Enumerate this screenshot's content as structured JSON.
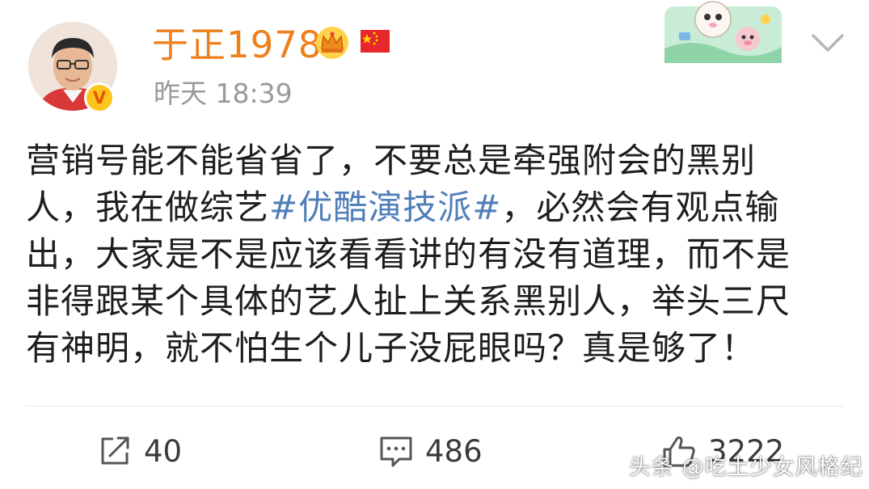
{
  "user": {
    "name": "于正1978",
    "verified_badge": "V",
    "timestamp": "昨天 18:39"
  },
  "post": {
    "text_line1": "营销号能不能省省了，不要总是牵强附会的黑别",
    "text_line2_pre": "人，我在做综艺",
    "hashtag": "#优酷演技派#",
    "text_line2_post": "，必然会有观点输",
    "text_line3": "出，大家是不是应该看看讲的有没有道理，而不是",
    "text_line4": "非得跟某个具体的艺人扯上关系黑别人，举头三尺",
    "text_line5": "有神明，就不怕生个儿子没屁眼吗？真是够了！"
  },
  "actions": {
    "repost_count": "40",
    "comment_count": "486",
    "like_count": "3222"
  },
  "watermark": "头条 @吃土少女风格纪",
  "icons": [
    "avatar",
    "crown-icon",
    "china-flag-icon",
    "sticker-icon",
    "chevron-down-icon",
    "repost-icon",
    "comment-icon",
    "like-icon"
  ],
  "colors": {
    "username": "#ef7f1b",
    "hashtag": "#4f7eb8",
    "timestamp": "#9a9a9a",
    "text": "#1e1e1e",
    "badge": "#ffc41e"
  }
}
